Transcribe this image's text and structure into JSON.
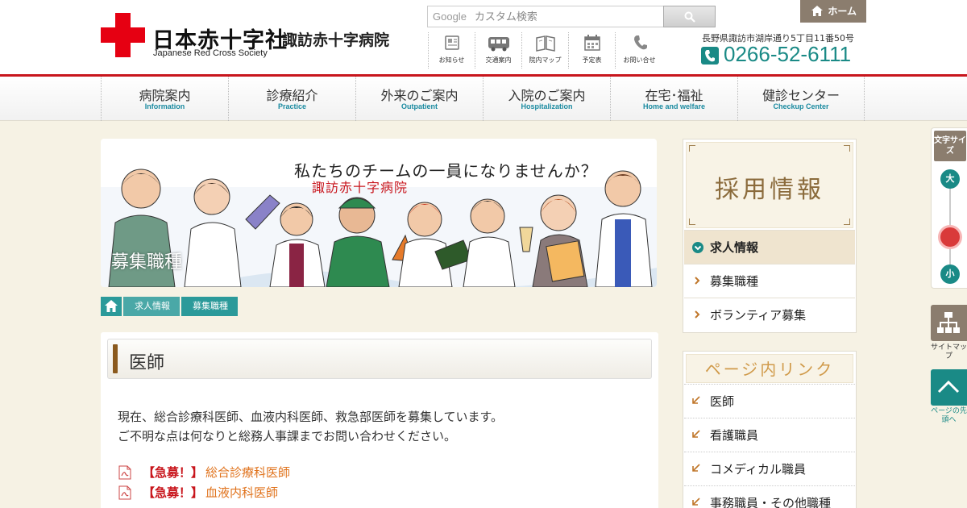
{
  "header": {
    "logo_jp": "日本赤十字社",
    "logo_en": "Japanese Red Cross Society",
    "hospital_name": "諏訪赤十字病院",
    "search": {
      "brand": "Google",
      "placeholder": "カスタム検索"
    },
    "home_label": "ホーム",
    "quick_links": [
      {
        "label": "お知らせ",
        "icon": "news-icon"
      },
      {
        "label": "交通案内",
        "icon": "bus-icon"
      },
      {
        "label": "院内マップ",
        "icon": "map-icon"
      },
      {
        "label": "予定表",
        "icon": "calendar-icon"
      },
      {
        "label": "お問い合せ",
        "icon": "phone-icon"
      }
    ],
    "address": "長野県諏訪市湖岸通り5丁目11番50号",
    "phone": "0266-52-6111"
  },
  "nav": [
    {
      "jp": "病院案内",
      "en": "Information"
    },
    {
      "jp": "診療紹介",
      "en": "Practice"
    },
    {
      "jp": "外来のご案内",
      "en": "Outpatient"
    },
    {
      "jp": "入院のご案内",
      "en": "Hospitalization"
    },
    {
      "jp": "在宅･福祉",
      "en": "Home and welfare"
    },
    {
      "jp": "健診センター",
      "en": "Checkup Center"
    }
  ],
  "hero": {
    "tagline": "私たちのチームの一員になりませんか？",
    "subtitle": "諏訪赤十字病院",
    "title": "募集職種"
  },
  "breadcrumb": [
    "求人情報",
    "募集職種"
  ],
  "content": {
    "heading": "医師",
    "intro_line1": "現在、総合診療科医師、血液内科医師、救急部医師を募集しています。",
    "intro_line2": "ご不明な点は何なりと総務人事課までお問い合わせください。",
    "jobs": [
      {
        "tag": "【急募！】",
        "link": "総合診療科医師"
      },
      {
        "tag": "【急募！】",
        "link": "血液内科医師"
      }
    ]
  },
  "sidebar": {
    "title": "採用情報",
    "items": [
      {
        "label": "求人情報",
        "active": true
      },
      {
        "label": "募集職種",
        "active": false
      },
      {
        "label": "ボランティア募集",
        "active": false
      }
    ],
    "page_links_title": "ページ内リンク",
    "page_links": [
      "医師",
      "看護職員",
      "コメディカル職員",
      "事務職員・その他職種"
    ]
  },
  "widgets": {
    "font_size_label": "文字サイズ",
    "font_big": "大",
    "font_small": "小",
    "sitemap_label": "サイトマップ",
    "totop_label": "ページの先頭へ"
  },
  "colors": {
    "brand_red": "#e60012",
    "teal": "#1a8a86",
    "accent_orange": "#e0731d",
    "brown": "#8b7d6e"
  }
}
